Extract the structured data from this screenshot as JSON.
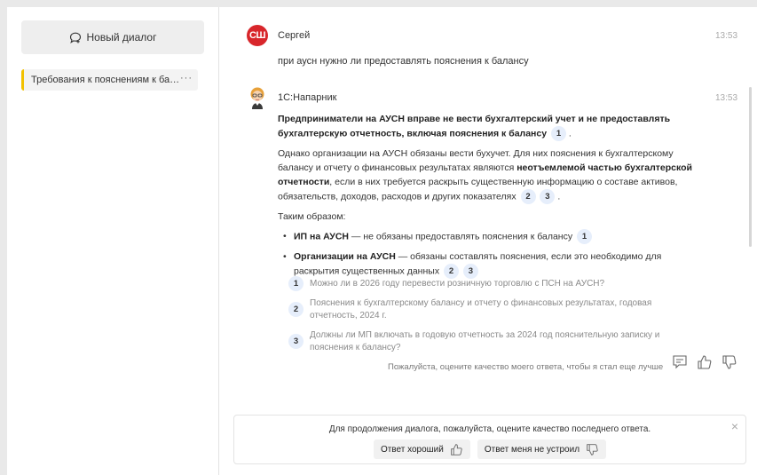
{
  "sidebar": {
    "new_dialog_label": "Новый диалог",
    "conversations": [
      {
        "title": "Требования к пояснениям к баланс...",
        "more": "···"
      }
    ]
  },
  "messages": {
    "user": {
      "avatar": "СШ",
      "author": "Сергей",
      "time": "13:53",
      "text": "при аусн нужно ли предоставлять пояснения к балансу"
    },
    "bot": {
      "author": "1С:Напарник",
      "time": "13:53",
      "p1_bold": "Предприниматели на АУСН вправе не вести бухгалтерский учет и не предоставлять бухгалтерскую отчетность, включая пояснения к балансу",
      "p1_refs": [
        "1"
      ],
      "p2_a": "Однако организации на АУСН обязаны вести бухучет. Для них пояснения к бухгалтерскому балансу и отчету о финансовых результатах являются ",
      "p2_bold": "неотъемлемой частью бухгалтерской отчетности",
      "p2_b": ", если в них требуется раскрыть существенную информацию о составе активов, обязательств, доходов, расходов и других показателях",
      "p2_refs": [
        "2",
        "3"
      ],
      "p3": "Таким образом:",
      "bullets": [
        {
          "bold": "ИП на АУСН",
          "text": " — не обязаны предоставлять пояснения к балансу",
          "refs": [
            "1"
          ]
        },
        {
          "bold": "Организации на АУСН",
          "text": " — обязаны составлять пояснения, если это необходимо для раскрытия существенных данных",
          "refs": [
            "2",
            "3"
          ]
        }
      ],
      "sources": [
        {
          "num": "1",
          "text": "Можно ли в 2026 году перевести розничную торговлю с ПСН на АУСН?"
        },
        {
          "num": "2",
          "text": "Пояснения к бухгалтерскому балансу и отчету о финансовых результатах, годовая отчетность, 2024 г."
        },
        {
          "num": "3",
          "text": "Должны ли МП включать в годовую отчетность за 2024 год пояснительную записку и пояснения к балансу?"
        }
      ],
      "rate_hint": "Пожалуйста, оцените качество моего ответа, чтобы я стал еще лучше"
    }
  },
  "rate_panel": {
    "prompt": "Для продолжения диалога, пожалуйста, оцените качество последнего ответа.",
    "good_label": "Ответ хороший",
    "bad_label": "Ответ меня не устроил",
    "close": "×"
  },
  "colors": {
    "accent": "#f2c100",
    "user_avatar": "#d8262b",
    "badge_bg": "#e6eefb"
  }
}
